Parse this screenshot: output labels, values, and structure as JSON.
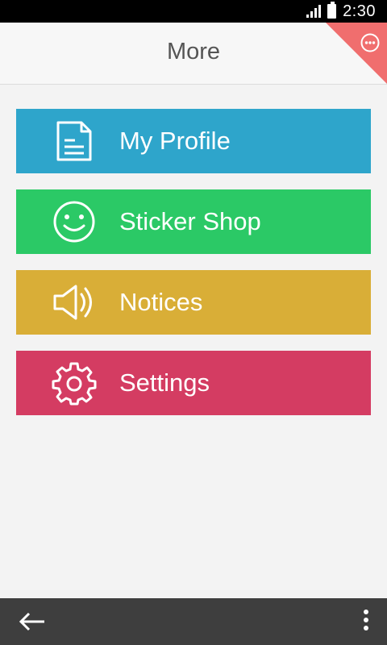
{
  "status_bar": {
    "time": "2:30"
  },
  "header": {
    "title": "More",
    "badge_icon": "more-circle-icon",
    "badge_color": "#f06e6e"
  },
  "menu": {
    "items": [
      {
        "label": "My Profile",
        "icon": "document-icon",
        "color": "#2ea5cb"
      },
      {
        "label": "Sticker Shop",
        "icon": "smiley-icon",
        "color": "#2bc966"
      },
      {
        "label": "Notices",
        "icon": "speaker-icon",
        "color": "#d9ae37"
      },
      {
        "label": "Settings",
        "icon": "gear-icon",
        "color": "#d43c62"
      }
    ]
  },
  "bottom_bar": {
    "back_icon": "back-arrow-icon",
    "overflow_icon": "overflow-menu-icon"
  }
}
